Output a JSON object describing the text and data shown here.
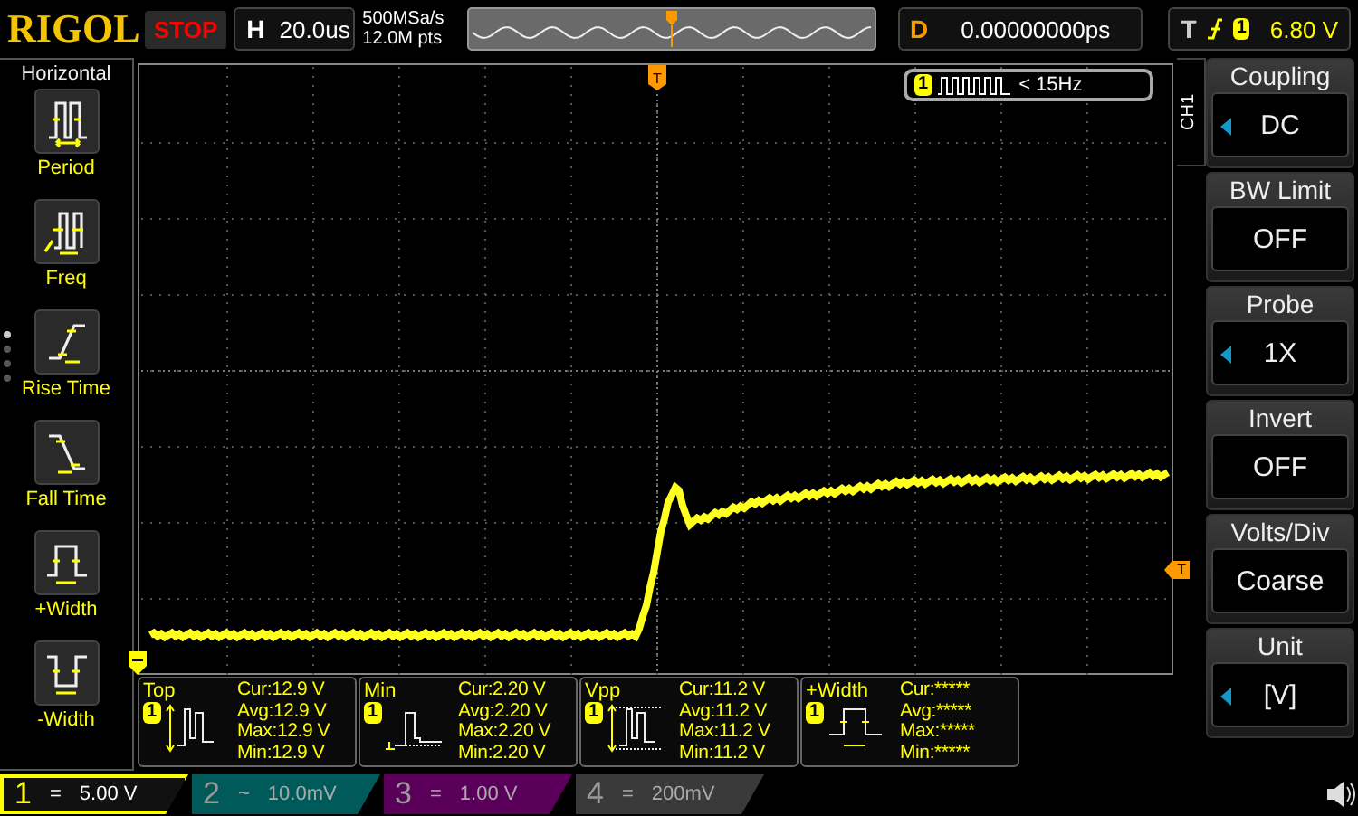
{
  "header": {
    "logo": "RIGOL",
    "run_state": "STOP",
    "horizontal": {
      "label": "H",
      "value": "20.0us"
    },
    "sample_rate": "500MSa/s",
    "memory_depth": "12.0M pts",
    "delay": {
      "label": "D",
      "value": "0.00000000ps"
    },
    "trigger": {
      "label": "T",
      "channel": "1",
      "level": "6.80 V"
    }
  },
  "sidebar": {
    "title": "Horizontal",
    "page_dots": [
      {
        "selected": true
      },
      {
        "selected": false
      },
      {
        "selected": false
      },
      {
        "selected": false
      }
    ],
    "items": [
      {
        "kind": "period",
        "label": "Period"
      },
      {
        "kind": "freq",
        "label": "Freq"
      },
      {
        "kind": "rise",
        "label": "Rise Time"
      },
      {
        "kind": "fall",
        "label": "Fall Time"
      },
      {
        "kind": "pwidth",
        "label": "+Width"
      },
      {
        "kind": "nwidth",
        "label": "-Width"
      }
    ]
  },
  "screen": {
    "trigger_status": {
      "channel": "1",
      "text": "< 15Hz"
    },
    "trigger_position_marker": "T",
    "trigger_level_marker": "T"
  },
  "menu": {
    "channel": "CH1",
    "items": [
      {
        "title": "Coupling",
        "value": "DC",
        "adjustable": true
      },
      {
        "title": "BW Limit",
        "value": "OFF",
        "adjustable": false
      },
      {
        "title": "Probe",
        "value": "1X",
        "adjustable": true
      },
      {
        "title": "Invert",
        "value": "OFF",
        "adjustable": false
      },
      {
        "title": "Volts/Div",
        "value": "Coarse",
        "adjustable": false
      },
      {
        "title": "Unit",
        "value": "[V]",
        "adjustable": true
      }
    ]
  },
  "measurements": [
    {
      "kind": "top",
      "name": "Top",
      "channel": "1",
      "readings": [
        {
          "label": "Cur:",
          "value": "12.9 V"
        },
        {
          "label": "Avg:",
          "value": "12.9 V"
        },
        {
          "label": "Max:",
          "value": "12.9 V"
        },
        {
          "label": "Min:",
          "value": "12.9 V"
        }
      ]
    },
    {
      "kind": "min",
      "name": "Min",
      "channel": "1",
      "readings": [
        {
          "label": "Cur:",
          "value": "2.20 V"
        },
        {
          "label": "Avg:",
          "value": "2.20 V"
        },
        {
          "label": "Max:",
          "value": "2.20 V"
        },
        {
          "label": "Min:",
          "value": "2.20 V"
        }
      ]
    },
    {
      "kind": "vpp",
      "name": "Vpp",
      "channel": "1",
      "readings": [
        {
          "label": "Cur:",
          "value": "11.2 V"
        },
        {
          "label": "Avg:",
          "value": "11.2 V"
        },
        {
          "label": "Max:",
          "value": "11.2 V"
        },
        {
          "label": "Min:",
          "value": "11.2 V"
        }
      ]
    },
    {
      "kind": "pwidth",
      "name": "+Width",
      "channel": "1",
      "readings": [
        {
          "label": "Cur:",
          "value": "*****"
        },
        {
          "label": "Avg:",
          "value": "*****"
        },
        {
          "label": "Max:",
          "value": "*****"
        },
        {
          "label": "Min:",
          "value": "*****"
        }
      ]
    }
  ],
  "channels": [
    {
      "number": "1",
      "coupling": "=",
      "scale": "5.00 V",
      "selected": true,
      "color": "#ffff00"
    },
    {
      "number": "2",
      "coupling": "~",
      "scale": "10.0mV",
      "selected": false,
      "color": "#005a5a"
    },
    {
      "number": "3",
      "coupling": "=",
      "scale": "1.00 V",
      "selected": false,
      "color": "#5a005a"
    },
    {
      "number": "4",
      "coupling": "=",
      "scale": "200mV",
      "selected": false,
      "color": "#3a3a3a"
    }
  ]
}
